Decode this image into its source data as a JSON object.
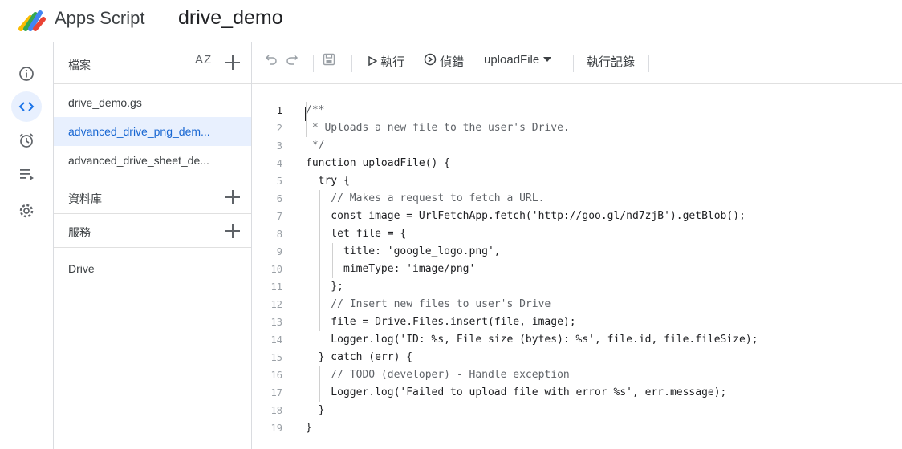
{
  "header": {
    "app_name": "Apps Script",
    "project_name": "drive_demo"
  },
  "rail": {
    "items": [
      "info-icon",
      "code-icon",
      "triggers-icon",
      "executions-icon",
      "settings-icon"
    ]
  },
  "files_panel": {
    "title": "檔案",
    "sort_label": "AZ",
    "files": [
      {
        "name": "drive_demo.gs",
        "active": false
      },
      {
        "name": "advanced_drive_png_dem...",
        "active": true
      },
      {
        "name": "advanced_drive_sheet_de...",
        "active": false
      }
    ],
    "libraries_label": "資料庫",
    "services_label": "服務",
    "services": [
      "Drive"
    ]
  },
  "toolbar": {
    "run_label": "執行",
    "debug_label": "偵錯",
    "function_name": "uploadFile",
    "log_label": "執行記錄"
  },
  "editor": {
    "line_numbers": [
      "1",
      "2",
      "3",
      "4",
      "5",
      "6",
      "7",
      "8",
      "9",
      "10",
      "11",
      "12",
      "13",
      "14",
      "15",
      "16",
      "17",
      "18",
      "19"
    ],
    "lines": [
      "/**",
      " * Uploads a new file to the user's Drive.",
      " */",
      "function uploadFile() {",
      "  try {",
      "    // Makes a request to fetch a URL.",
      "    const image = UrlFetchApp.fetch('http://goo.gl/nd7zjB').getBlob();",
      "    let file = {",
      "      title: 'google_logo.png',",
      "      mimeType: 'image/png'",
      "    };",
      "    // Insert new files to user's Drive",
      "    file = Drive.Files.insert(file, image);",
      "    Logger.log('ID: %s, File size (bytes): %s', file.id, file.fileSize);",
      "  } catch (err) {",
      "    // TODO (developer) - Handle exception",
      "    Logger.log('Failed to upload file with error %s', err.message);",
      "  }",
      "}"
    ]
  },
  "colors": {
    "accent": "#1a73e8",
    "active_bg": "#e8f0fe",
    "string": "#c5221f",
    "comment": "#5f6368"
  }
}
